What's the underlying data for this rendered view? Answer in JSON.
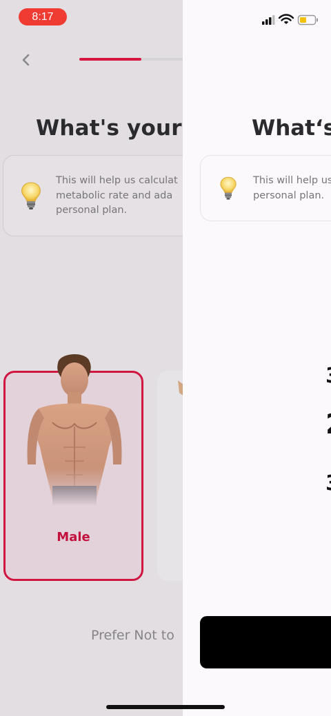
{
  "status_bar": {
    "time": "8:17",
    "battery_color": "#f4c20d",
    "recording_pill_color": "#ef3b32"
  },
  "header": {
    "progress_fraction": 0.36,
    "accent_color": "#d7163f"
  },
  "left_screen": {
    "title": "What's your g",
    "info_text": "This will help us calculat metabolic rate and ada personal plan.",
    "male_label": "Male",
    "prefer_text": "Prefer Not to"
  },
  "right_screen": {
    "title": "What‘s",
    "info_text_line1": "This will help us",
    "info_text_line2": "personal plan.",
    "picker_digits": [
      "3",
      "2",
      "3"
    ]
  }
}
